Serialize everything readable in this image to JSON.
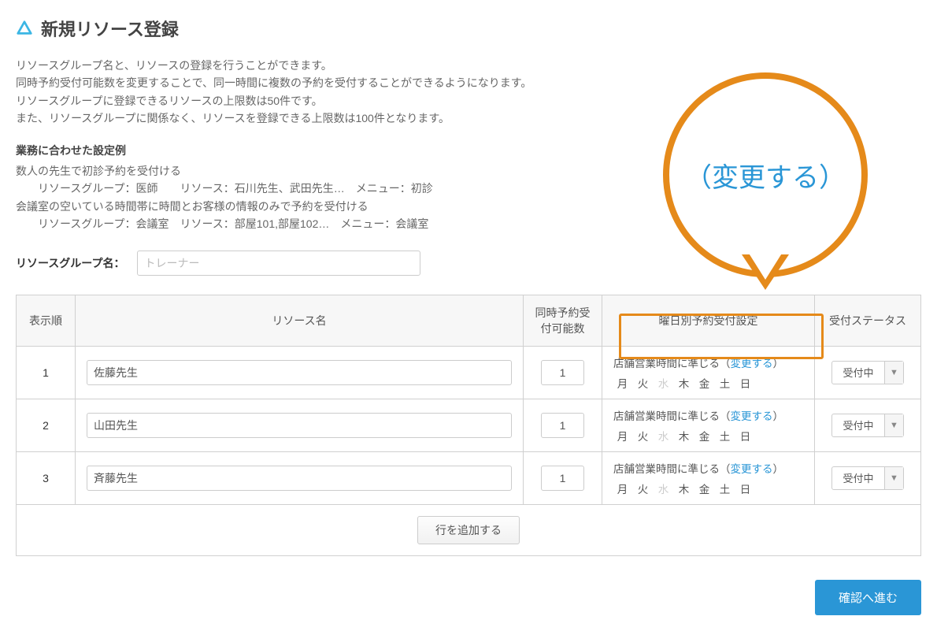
{
  "title": "新規リソース登録",
  "desc": {
    "line1": "リソースグループ名と、リソースの登録を行うことができます。",
    "line2": "同時予約受付可能数を変更することで、同一時間に複数の予約を受付することができるようになります。",
    "line3": "リソースグループに登録できるリソースの上限数は50件です。",
    "line4": "また、リソースグループに関係なく、リソースを登録できる上限数は100件となります。"
  },
  "example": {
    "heading": "業務に合わせた設定例",
    "case1_line1": "数人の先生で初診予約を受付ける",
    "case1_line2": "リソースグループ：医師　　リソース：石川先生、武田先生…　メニュー：初診",
    "case2_line1": "会議室の空いている時間帯に時間とお客様の情報のみで予約を受付ける",
    "case2_line2": "リソースグループ：会議室　リソース：部屋101,部屋102…　メニュー：会議室"
  },
  "group": {
    "label": "リソースグループ名：",
    "placeholder": "トレーナー"
  },
  "columns": {
    "order": "表示順",
    "name": "リソース名",
    "capacity": "同時予約受付可能数",
    "schedule": "曜日別予約受付設定",
    "status": "受付ステータス"
  },
  "schedule_text": {
    "prefix": "店舗営業時間に準じる（",
    "link": "変更する",
    "suffix": "）"
  },
  "days": [
    "月",
    "火",
    "水",
    "木",
    "金",
    "土",
    "日"
  ],
  "day_off_index": 2,
  "rows": [
    {
      "order": "1",
      "name": "佐藤先生",
      "capacity": "1",
      "status": "受付中"
    },
    {
      "order": "2",
      "name": "山田先生",
      "capacity": "1",
      "status": "受付中"
    },
    {
      "order": "3",
      "name": "斉藤先生",
      "capacity": "1",
      "status": "受付中"
    }
  ],
  "add_label": "行を追加する",
  "confirm_label": "確認へ進む",
  "callout_text": "（変更する）"
}
